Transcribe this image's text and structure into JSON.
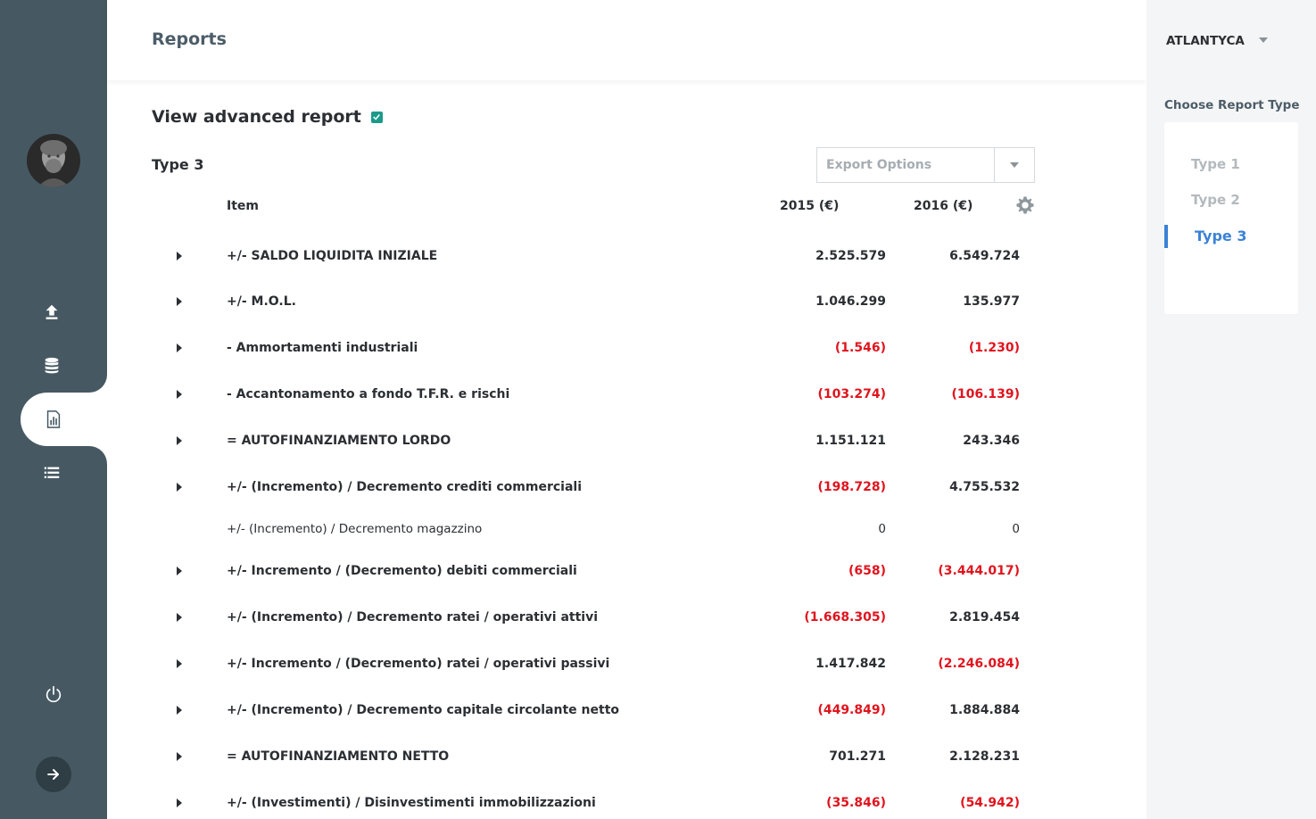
{
  "header": {
    "title": "Reports"
  },
  "user": {
    "name": "ATLANTYCA"
  },
  "advanced": {
    "label": "View advanced report",
    "checked": true
  },
  "report": {
    "type_title": "Type 3",
    "export_placeholder": "Export Options",
    "columns": {
      "item": "Item",
      "y2015": "2015 (€)",
      "y2016": "2016 (€)"
    },
    "rows": [
      {
        "label": "+/- SALDO LIQUIDITA INIZIALE",
        "v2015": "2.525.579",
        "v2016": "6.549.724",
        "neg2015": false,
        "neg2016": false,
        "expandable": true
      },
      {
        "label": "+/- M.O.L.",
        "v2015": "1.046.299",
        "v2016": "135.977",
        "neg2015": false,
        "neg2016": false,
        "expandable": true
      },
      {
        "label": "- Ammortamenti industriali",
        "v2015": "(1.546)",
        "v2016": "(1.230)",
        "neg2015": true,
        "neg2016": true,
        "expandable": true
      },
      {
        "label": "- Accantonamento a fondo T.F.R. e rischi",
        "v2015": "(103.274)",
        "v2016": "(106.139)",
        "neg2015": true,
        "neg2016": true,
        "expandable": true
      },
      {
        "label": "= AUTOFINANZIAMENTO LORDO",
        "v2015": "1.151.121",
        "v2016": "243.346",
        "neg2015": false,
        "neg2016": false,
        "expandable": true
      },
      {
        "label": "+/- (Incremento) / Decremento crediti commerciali",
        "v2015": "(198.728)",
        "v2016": "4.755.532",
        "neg2015": true,
        "neg2016": false,
        "expandable": true
      },
      {
        "label": "+/- (Incremento) / Decremento magazzino",
        "v2015": "0",
        "v2016": "0",
        "neg2015": false,
        "neg2016": false,
        "expandable": false
      },
      {
        "label": "+/- Incremento / (Decremento) debiti commerciali",
        "v2015": "(658)",
        "v2016": "(3.444.017)",
        "neg2015": true,
        "neg2016": true,
        "expandable": true
      },
      {
        "label": "+/- (Incremento) / Decremento ratei / operativi attivi",
        "v2015": "(1.668.305)",
        "v2016": "2.819.454",
        "neg2015": true,
        "neg2016": false,
        "expandable": true
      },
      {
        "label": "+/- Incremento / (Decremento) ratei / operativi passivi",
        "v2015": "1.417.842",
        "v2016": "(2.246.084)",
        "neg2015": false,
        "neg2016": true,
        "expandable": true
      },
      {
        "label": "+/- (Incremento) / Decremento capitale circolante netto",
        "v2015": "(449.849)",
        "v2016": "1.884.884",
        "neg2015": true,
        "neg2016": false,
        "expandable": true
      },
      {
        "label": "= AUTOFINANZIAMENTO NETTO",
        "v2015": "701.271",
        "v2016": "2.128.231",
        "neg2015": false,
        "neg2016": false,
        "expandable": true
      },
      {
        "label": "+/- (Investimenti) / Disinvestimenti immobilizzazioni",
        "v2015": "(35.846)",
        "v2016": "(54.942)",
        "neg2015": true,
        "neg2016": true,
        "expandable": true
      }
    ]
  },
  "report_types": {
    "label": "Choose Report Type",
    "items": [
      "Type 1",
      "Type 2",
      "Type 3"
    ],
    "selected": "Type 3"
  },
  "nav": {
    "items": [
      "upload-icon",
      "database-icon",
      "report-icon",
      "list-icon"
    ],
    "active": "report-icon"
  },
  "colors": {
    "sidebar": "#465963",
    "accent": "#3b82d6",
    "negative": "#e0141e",
    "checkbox": "#1b9a8a"
  }
}
